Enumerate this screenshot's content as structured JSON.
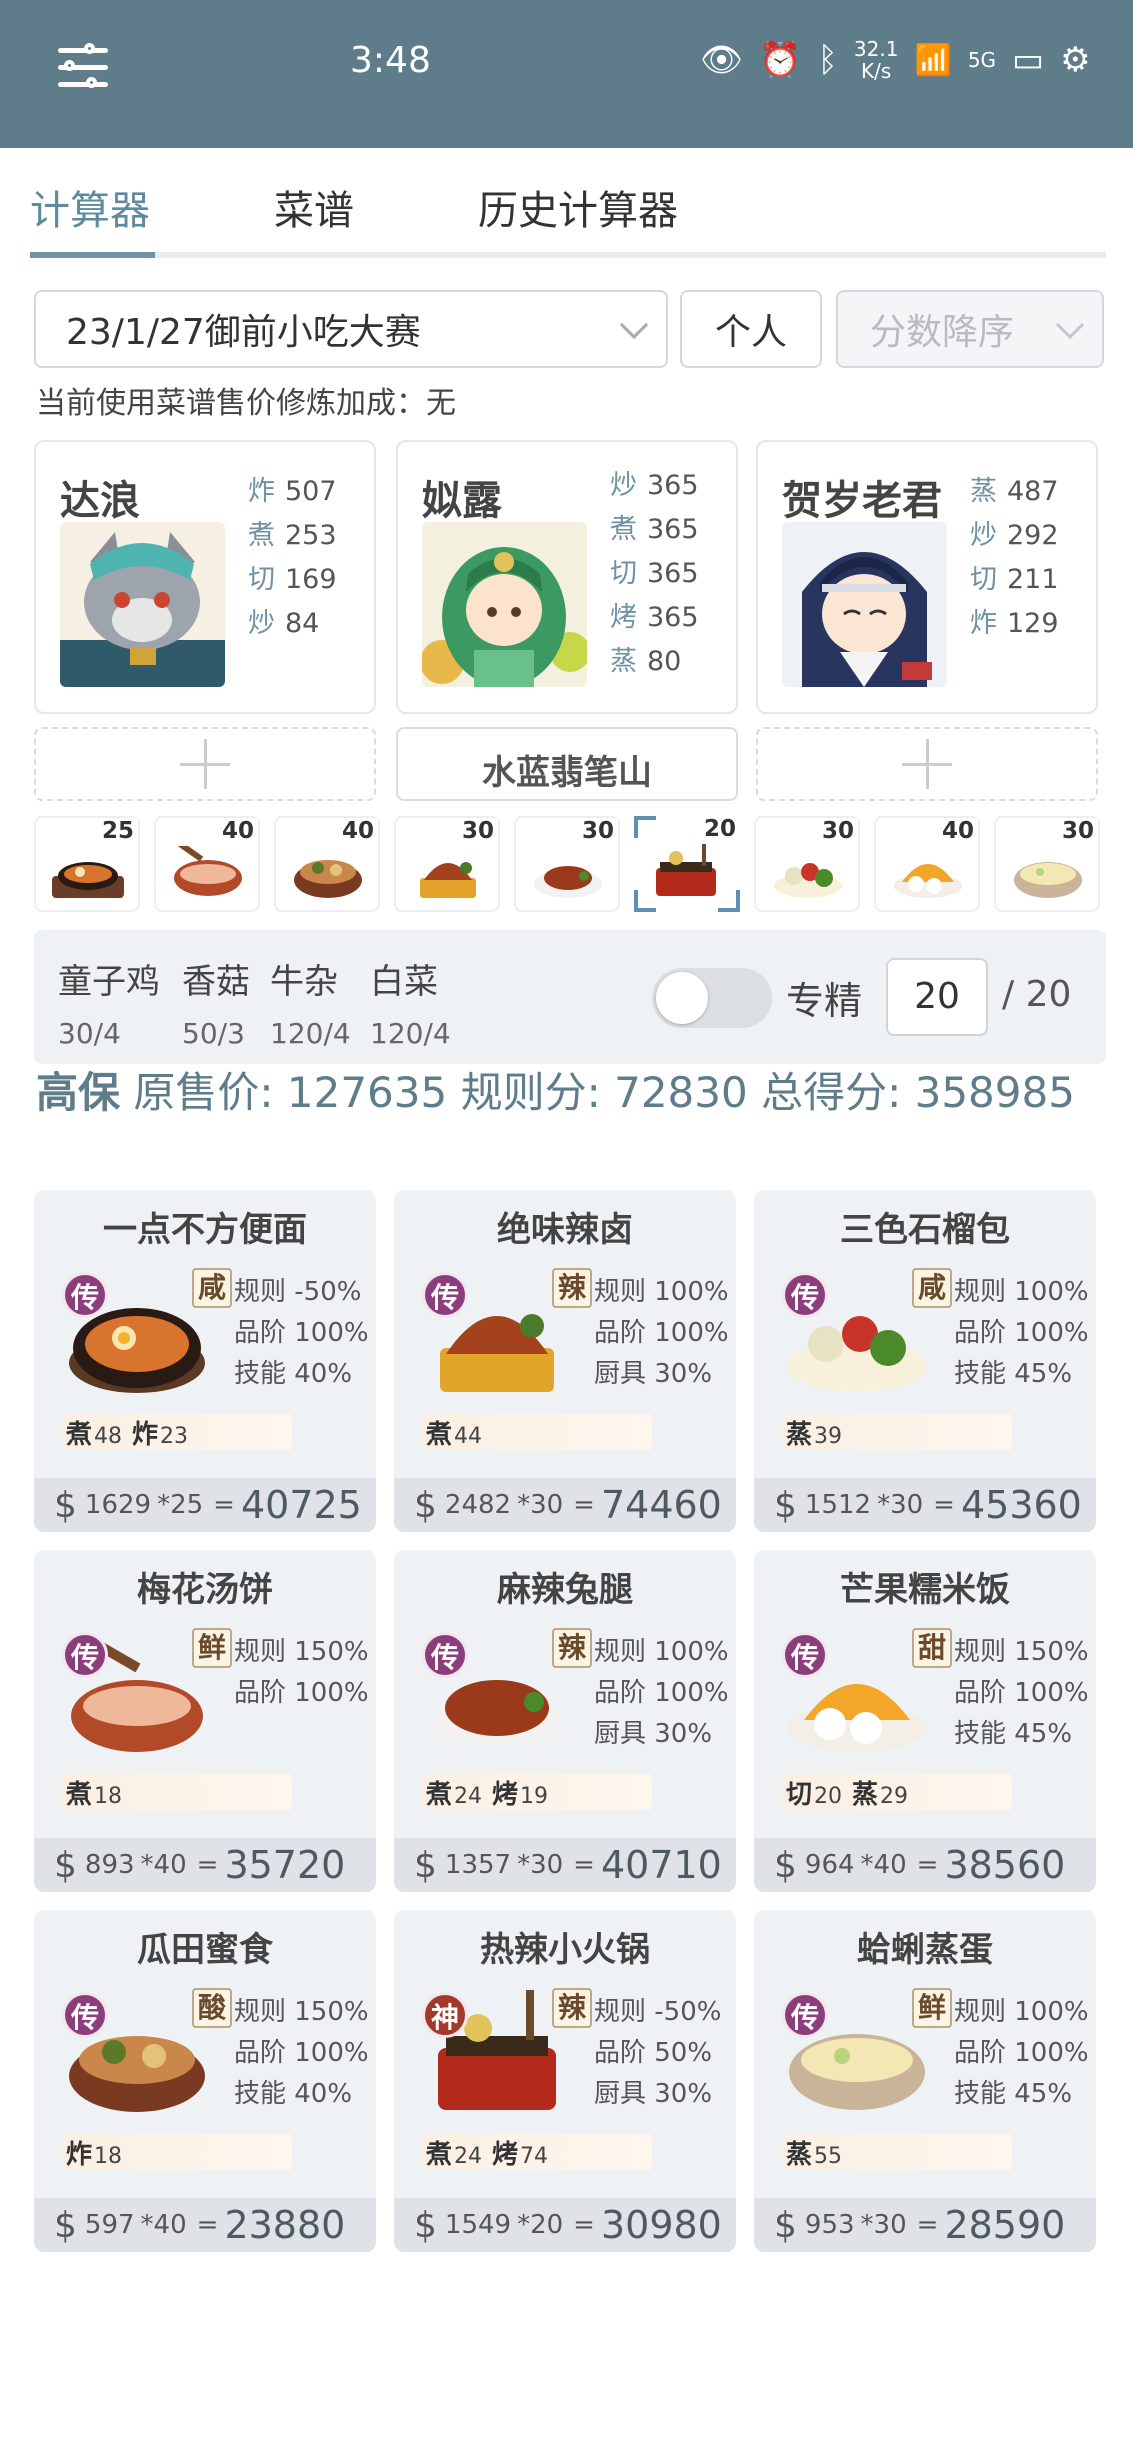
{
  "status": {
    "time": "3:48",
    "speed_value": "32.1",
    "speed_unit": "K/s",
    "network": "5G"
  },
  "tabs": [
    {
      "label": "计算器",
      "active": true
    },
    {
      "label": "菜谱",
      "active": false
    },
    {
      "label": "历史计算器",
      "active": false
    }
  ],
  "filters": {
    "contest": "23/1/27御前小吃大赛",
    "mode": "个人",
    "sort": "分数降序"
  },
  "note": "当前使用菜谱售价修炼加成：无",
  "chefs": [
    {
      "name": "达浪",
      "skills": [
        {
          "k": "炸",
          "v": "507"
        },
        {
          "k": "煮",
          "v": "253"
        },
        {
          "k": "切",
          "v": "169"
        },
        {
          "k": "炒",
          "v": "84"
        }
      ]
    },
    {
      "name": "姒露",
      "skills": [
        {
          "k": "炒",
          "v": "365"
        },
        {
          "k": "煮",
          "v": "365"
        },
        {
          "k": "切",
          "v": "365"
        },
        {
          "k": "烤",
          "v": "365"
        },
        {
          "k": "蒸",
          "v": "80"
        }
      ]
    },
    {
      "name": "贺岁老君",
      "skills": [
        {
          "k": "蒸",
          "v": "487"
        },
        {
          "k": "炒",
          "v": "292"
        },
        {
          "k": "切",
          "v": "211"
        },
        {
          "k": "炸",
          "v": "129"
        }
      ]
    }
  ],
  "equipment": [
    "",
    "水蓝翡笔山",
    ""
  ],
  "dish_counts": [
    "25",
    "40",
    "40",
    "30",
    "30",
    "20",
    "30",
    "40",
    "30"
  ],
  "ingredients": [
    {
      "name": "童子鸡",
      "qty": "30/4"
    },
    {
      "name": "香菇",
      "qty": "50/3"
    },
    {
      "name": "牛杂",
      "qty": "120/4"
    },
    {
      "name": "白菜",
      "qty": "120/4"
    }
  ],
  "specialize": {
    "label": "专精",
    "value": "20",
    "total": "/ 20",
    "enabled": false
  },
  "summary": {
    "grade": "高保",
    "orig_label": "原售价:",
    "orig": "127635",
    "rule_label": "规则分:",
    "rule": "72830",
    "total_label": "总得分:",
    "total": "358985"
  },
  "recipes": [
    {
      "name": "一点不方便面",
      "rank": "传",
      "flavor": "咸",
      "stats": [
        "规则 -50%",
        "品阶 100%",
        "技能 40%"
      ],
      "reqs": [
        {
          "k": "煮",
          "v": "48"
        },
        {
          "k": "炸",
          "v": "23"
        }
      ],
      "price": "1629",
      "mult": "*25",
      "total": "40725"
    },
    {
      "name": "绝味辣卤",
      "rank": "传",
      "flavor": "辣",
      "stats": [
        "规则 100%",
        "品阶 100%",
        "厨具 30%"
      ],
      "reqs": [
        {
          "k": "煮",
          "v": "44"
        }
      ],
      "price": "2482",
      "mult": "*30",
      "total": "74460"
    },
    {
      "name": "三色石榴包",
      "rank": "传",
      "flavor": "咸",
      "stats": [
        "规则 100%",
        "品阶 100%",
        "技能 45%"
      ],
      "reqs": [
        {
          "k": "蒸",
          "v": "39"
        }
      ],
      "price": "1512",
      "mult": "*30",
      "total": "45360"
    },
    {
      "name": "梅花汤饼",
      "rank": "传",
      "flavor": "鲜",
      "stats": [
        "规则 150%",
        "品阶 100%"
      ],
      "reqs": [
        {
          "k": "煮",
          "v": "18"
        }
      ],
      "price": "893",
      "mult": "*40",
      "total": "35720"
    },
    {
      "name": "麻辣兔腿",
      "rank": "传",
      "flavor": "辣",
      "stats": [
        "规则 100%",
        "品阶 100%",
        "厨具 30%"
      ],
      "reqs": [
        {
          "k": "煮",
          "v": "24"
        },
        {
          "k": "烤",
          "v": "19"
        }
      ],
      "price": "1357",
      "mult": "*30",
      "total": "40710"
    },
    {
      "name": "芒果糯米饭",
      "rank": "传",
      "flavor": "甜",
      "stats": [
        "规则 150%",
        "品阶 100%",
        "技能 45%"
      ],
      "reqs": [
        {
          "k": "切",
          "v": "20"
        },
        {
          "k": "蒸",
          "v": "29"
        }
      ],
      "price": "964",
      "mult": "*40",
      "total": "38560"
    },
    {
      "name": "瓜田蜜食",
      "rank": "传",
      "flavor": "酸",
      "stats": [
        "规则 150%",
        "品阶 100%",
        "技能 40%"
      ],
      "reqs": [
        {
          "k": "炸",
          "v": "18"
        }
      ],
      "price": "597",
      "mult": "*40",
      "total": "23880"
    },
    {
      "name": "热辣小火锅",
      "rank": "神",
      "flavor": "辣",
      "stats": [
        "规则 -50%",
        "品阶 50%",
        "厨具 30%"
      ],
      "reqs": [
        {
          "k": "煮",
          "v": "24"
        },
        {
          "k": "烤",
          "v": "74"
        }
      ],
      "price": "1549",
      "mult": "*20",
      "total": "30980"
    },
    {
      "name": "蛤蜊蒸蛋",
      "rank": "传",
      "flavor": "鲜",
      "stats": [
        "规则 100%",
        "品阶 100%",
        "技能 45%"
      ],
      "reqs": [
        {
          "k": "蒸",
          "v": "55"
        }
      ],
      "price": "953",
      "mult": "*30",
      "total": "28590"
    }
  ]
}
